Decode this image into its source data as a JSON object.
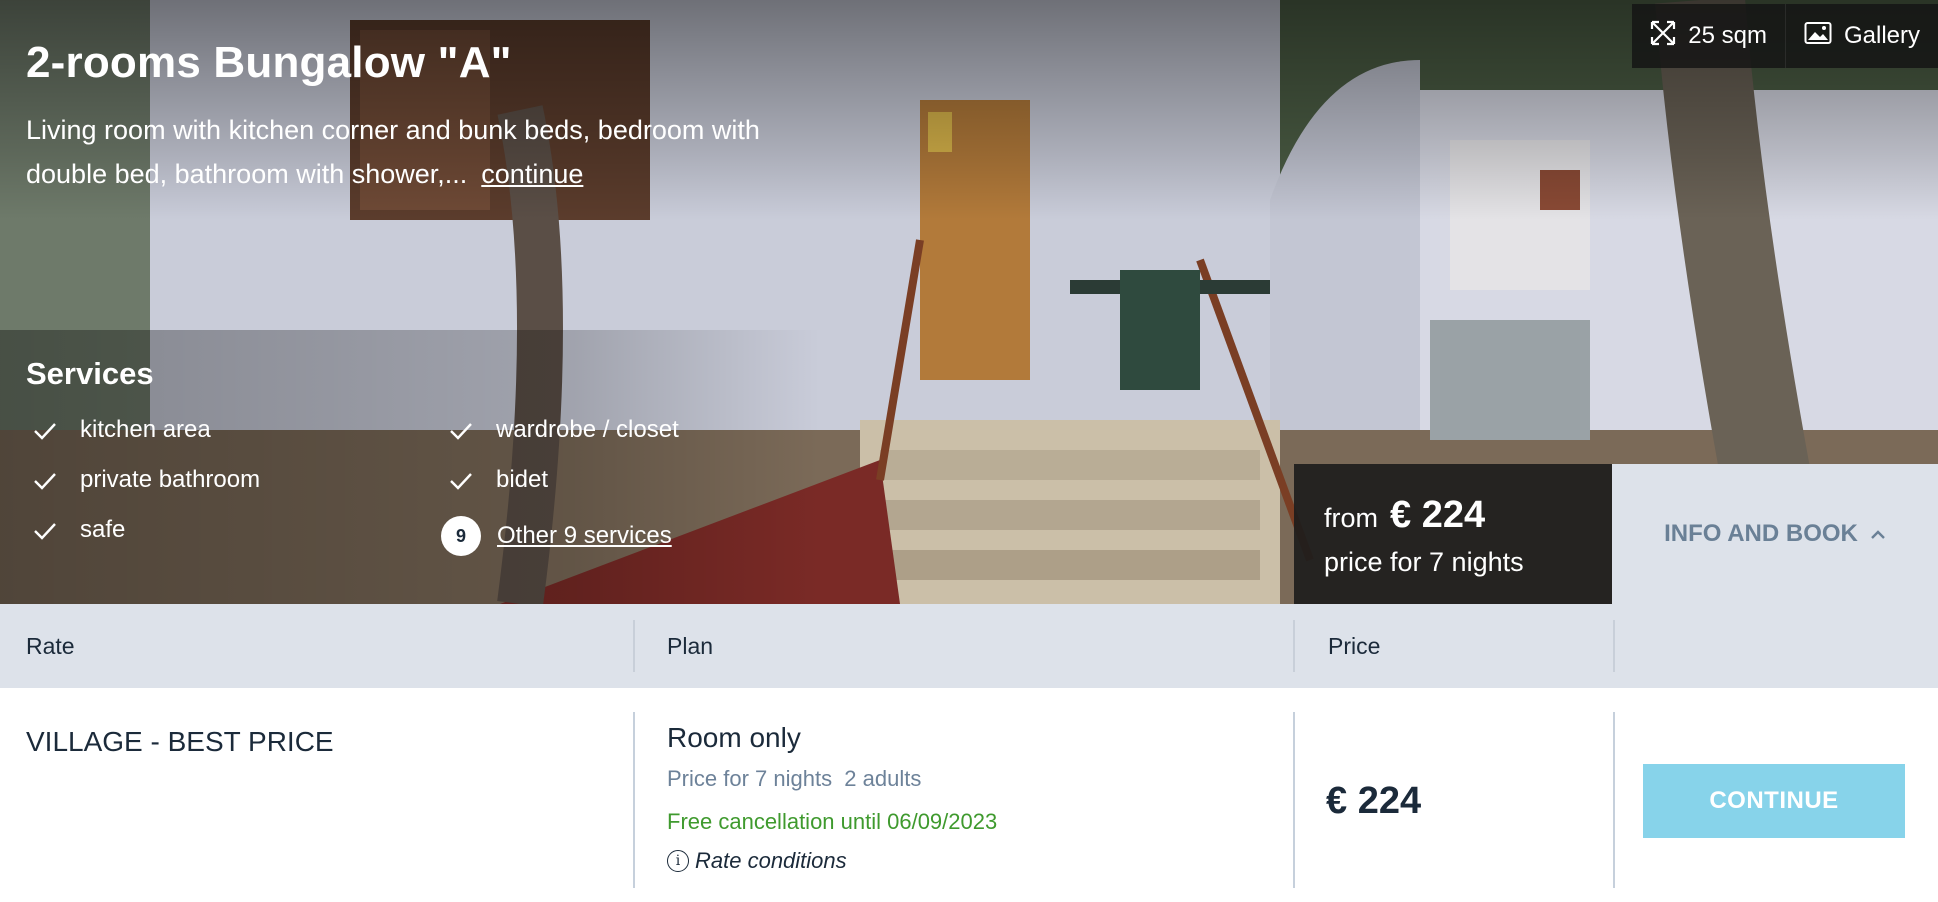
{
  "room": {
    "title": "2-rooms Bungalow \"A\"",
    "description": "Living room with kitchen corner and bunk beds, bedroom with double bed, bathroom with shower,...",
    "continue_link": "continue"
  },
  "topbar": {
    "size_label": "25 sqm",
    "size_icon": "expand-icon",
    "gallery_label": "Gallery",
    "gallery_icon": "image-icon"
  },
  "services": {
    "title": "Services",
    "items": [
      "kitchen area",
      "wardrobe / closet",
      "private bathroom",
      "bidet",
      "safe"
    ],
    "more_count": "9",
    "more_label": "Other 9 services"
  },
  "price_box": {
    "from_label": "from",
    "amount": "€ 224",
    "nights_label": "price for 7 nights"
  },
  "info_book": {
    "label": "INFO AND BOOK",
    "icon": "chevron-up-icon"
  },
  "table": {
    "headers": [
      "Rate",
      "Plan",
      "Price",
      ""
    ],
    "rows": [
      {
        "rate": "VILLAGE - BEST PRICE",
        "plan": "Room only",
        "plan_details": "Price for 7 nights  2 adults",
        "cancellation": "Free cancellation until 06/09/2023",
        "conditions_label": "Rate conditions",
        "price": "€ 224",
        "action_label": "CONTINUE"
      }
    ]
  },
  "colors": {
    "header_bg": "#dde2ea",
    "text_dark": "#1b2a3a",
    "muted_blue": "#6d8299",
    "green": "#3f9a2e",
    "continue_btn": "#87d3ea"
  }
}
